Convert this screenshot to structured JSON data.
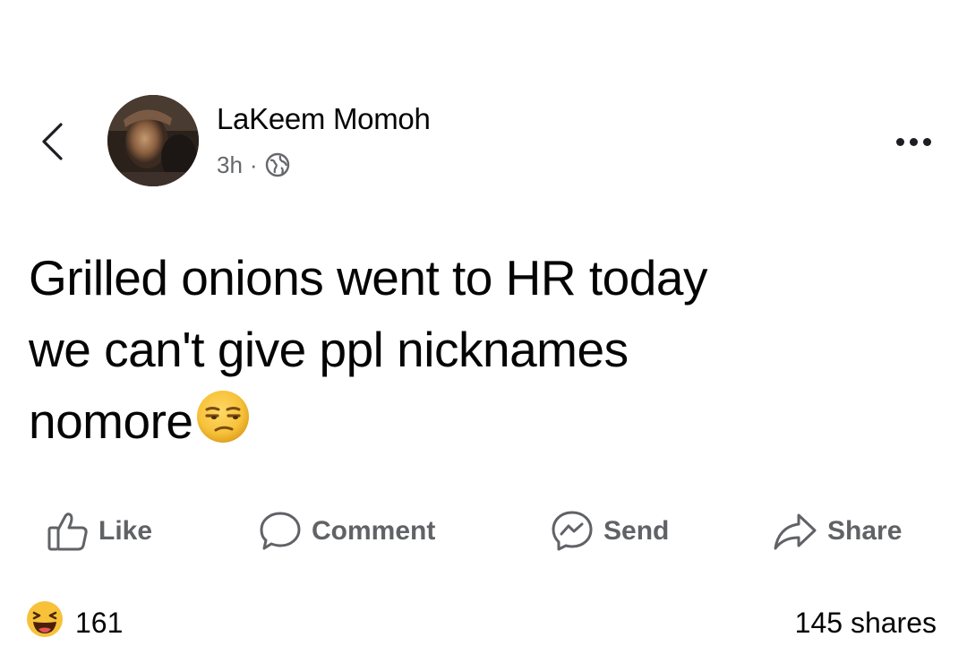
{
  "header": {
    "author_name": "LaKeem Momoh",
    "time": "3h",
    "separator": "·",
    "privacy_icon": "globe-icon",
    "back_icon": "chevron-left-icon",
    "more_icon": "more-horizontal-icon"
  },
  "post": {
    "text_lines": [
      "Grilled onions went to HR today",
      "we can't give ppl nicknames",
      "nomore"
    ],
    "trailing_emoji": "unamused-face-emoji"
  },
  "actions": {
    "like_label": "Like",
    "comment_label": "Comment",
    "send_label": "Send",
    "share_label": "Share"
  },
  "stats": {
    "reaction_icon": "haha-reaction-icon",
    "reaction_count": "161",
    "shares_text": "145 shares"
  },
  "colors": {
    "text_primary": "#050505",
    "text_secondary": "#65676b",
    "background": "#ffffff",
    "emoji_yellow": "#f7c23a"
  }
}
